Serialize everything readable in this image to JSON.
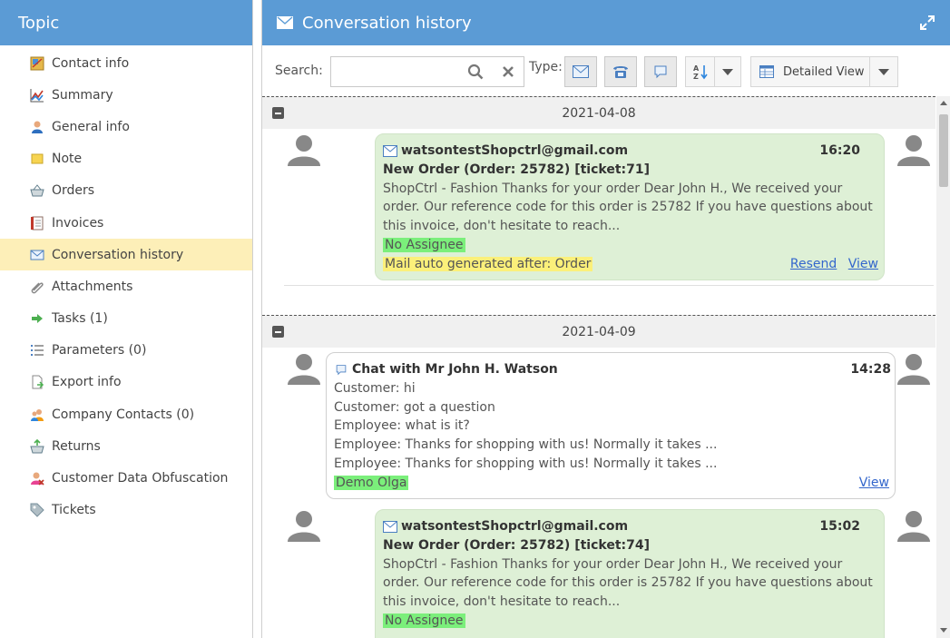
{
  "sidebar": {
    "title": "Topic",
    "items": [
      {
        "label": "Contact info",
        "icon": "contact-card-icon"
      },
      {
        "label": "Summary",
        "icon": "chart-icon"
      },
      {
        "label": "General info",
        "icon": "person-icon"
      },
      {
        "label": "Note",
        "icon": "note-icon"
      },
      {
        "label": "Orders",
        "icon": "basket-icon"
      },
      {
        "label": "Invoices",
        "icon": "invoice-icon"
      },
      {
        "label": "Conversation history",
        "icon": "envelope-icon",
        "active": true
      },
      {
        "label": "Attachments",
        "icon": "paperclip-icon"
      },
      {
        "label": "Tasks (1)",
        "icon": "arrow-right-icon"
      },
      {
        "label": "Parameters (0)",
        "icon": "list-icon"
      },
      {
        "label": "Export info",
        "icon": "export-icon"
      },
      {
        "label": "Company Contacts (0)",
        "icon": "people-icon"
      },
      {
        "label": "Returns",
        "icon": "return-box-icon"
      },
      {
        "label": "Customer Data Obfuscation",
        "icon": "person-x-icon"
      },
      {
        "label": "Tickets",
        "icon": "tag-icon"
      }
    ]
  },
  "panel": {
    "title": "Conversation history"
  },
  "toolbar": {
    "search_label": "Search:",
    "search_value": "",
    "type_label": "Type:",
    "view_label": "Detailed View"
  },
  "groups": [
    {
      "date": "2021-04-08",
      "messages": [
        {
          "kind": "mail",
          "from": "watsontestShopctrl@gmail.com",
          "time": "16:20",
          "subject": "New Order (Order: 25782) [ticket:71]",
          "body": "ShopCtrl - Fashion Thanks for your order Dear John H., We received your order. Our reference code for this order is 25782 If you have questions about this invoice, don't hesitate to reach...",
          "assignee": "No Assignee",
          "note": "Mail auto generated after: Order",
          "resend_label": "Resend",
          "view_label": "View"
        }
      ]
    },
    {
      "date": "2021-04-09",
      "messages": [
        {
          "kind": "chat",
          "title": "Chat with Mr John H. Watson",
          "time": "14:28",
          "lines": [
            "Customer: hi",
            "Customer: got a question",
            "Employee: what is it?",
            "Employee: Thanks for shopping with us! Normally it takes ...",
            "Employee: Thanks for shopping with us! Normally it takes ..."
          ],
          "assignee": "Demo Olga",
          "view_label": "View"
        },
        {
          "kind": "mail",
          "from": "watsontestShopctrl@gmail.com",
          "time": "15:02",
          "subject": "New Order (Order: 25782) [ticket:74]",
          "body": "ShopCtrl - Fashion Thanks for your order Dear John H., We received your order. Our reference code for this order is 25782 If you have questions about this invoice, don't hesitate to reach...",
          "assignee": "No Assignee"
        }
      ]
    }
  ],
  "colors": {
    "header_blue": "#5b9bd5",
    "active_item": "#fdefb8",
    "mail_bubble": "#def0d6",
    "assignee_highlight": "#7bef7b",
    "note_highlight": "#fbf07a",
    "link": "#3366cc"
  }
}
